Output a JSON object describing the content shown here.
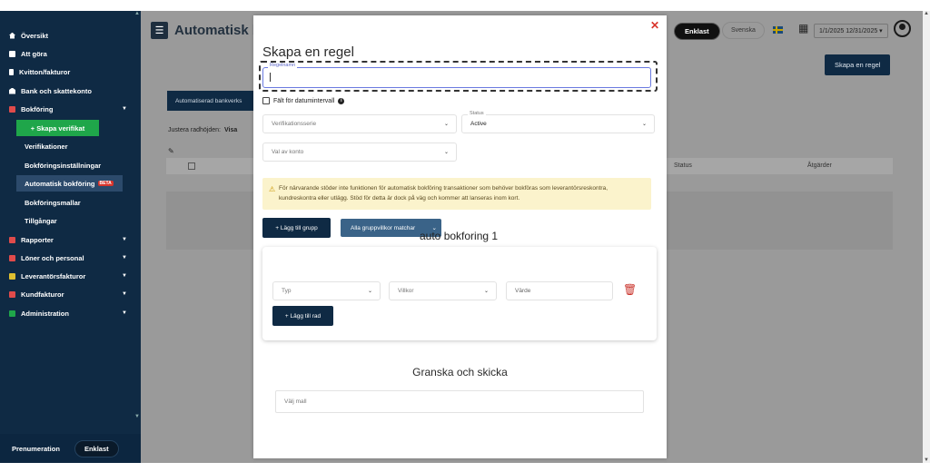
{
  "sidebar": {
    "items": [
      {
        "label": "Översikt",
        "icon": "home-icon",
        "color": "#ffffff"
      },
      {
        "label": "Att göra",
        "icon": "list-icon",
        "color": "#ffffff"
      },
      {
        "label": "Kvitton/fakturor",
        "icon": "receipt-icon",
        "color": "#ffffff"
      },
      {
        "label": "Bank och skattekonto",
        "icon": "bank-icon",
        "color": "#ffffff"
      },
      {
        "label": "Bokföring",
        "icon": "book-icon",
        "color": "#e04b4b"
      }
    ],
    "sub_items": {
      "skapa_verifikat": "+ Skapa verifikat",
      "verifikationer": "Verifikationer",
      "installningar": "Bokföringsinställningar",
      "automatisk": "Automatisk bokföring",
      "beta": "BETA",
      "mallar": "Bokföringsmallar",
      "tillgangar": "Tillgångar"
    },
    "items2": [
      {
        "label": "Rapporter",
        "icon": "chart-icon",
        "color": "#e04b4b"
      },
      {
        "label": "Löner och personal",
        "icon": "people-icon",
        "color": "#e04b4b"
      },
      {
        "label": "Leverantörsfakturor",
        "icon": "supplier-icon",
        "color": "#e0c030"
      },
      {
        "label": "Kundfakturor",
        "icon": "customer-icon",
        "color": "#e04b4b"
      },
      {
        "label": "Administration",
        "icon": "admin-icon",
        "color": "#1fa64a"
      }
    ],
    "bottom": {
      "label": "Prenumeration",
      "plan": "Enklast"
    }
  },
  "header": {
    "title": "Automatisk bo",
    "plan": "Enklast",
    "language": "Svenska",
    "date_range": "1/1/2025 12/31/2025",
    "skapa_regel": "Skapa en regel"
  },
  "background": {
    "tab": "Automatiserad bankverks",
    "justera": "Justera radhöjden:",
    "visa": "Visa",
    "status": "Status",
    "atgarder": "Åtgärder"
  },
  "modal": {
    "title": "Skapa en regel",
    "name_label": "Regelnamn",
    "name_value": "",
    "date_checkbox": "Fält för datumintervall",
    "verifikationsserie_placeholder": "Verifikationsserie",
    "status_label": "Status",
    "status_value": "Active",
    "konto_placeholder": "Val av konto",
    "notice": "För närvarande stöder inte funktionen för automatisk bokföring transaktioner som behöver bokföras som leverantörsreskontra, kundreskontra eller utlägg. Stöd för detta är dock på väg och kommer att lanseras inom kort.",
    "add_group": "+ Lägg till grupp",
    "match_mode": "Alla gruppvillkor matchar",
    "overlay_text": "auto bokforing 1",
    "typ_placeholder": "Typ",
    "villkor_placeholder": "Villkor",
    "varde_placeholder": "Värde",
    "add_row": "+ Lägg till rad",
    "review_title": "Granska och skicka",
    "template_placeholder": "Välj mall"
  }
}
